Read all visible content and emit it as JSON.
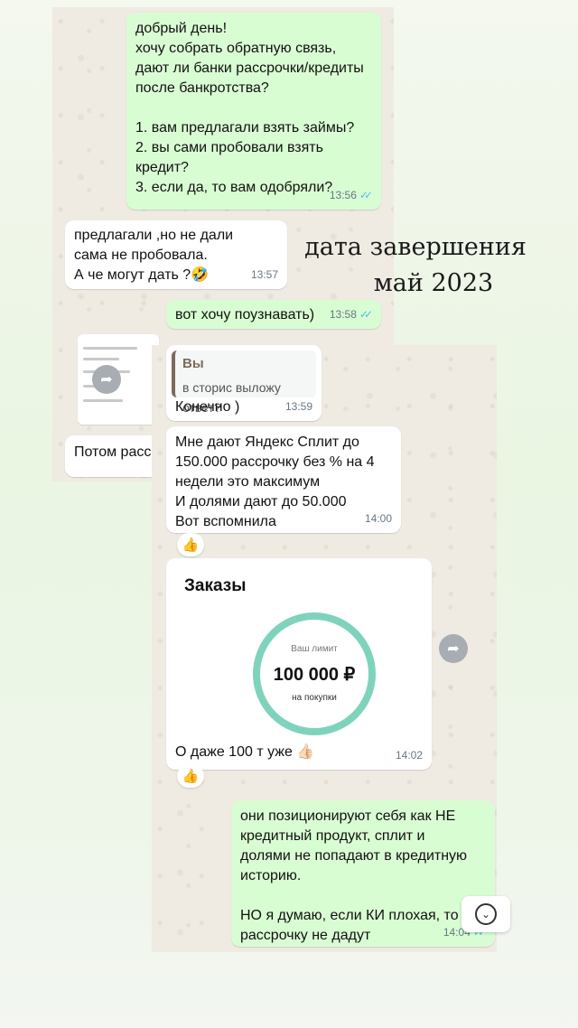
{
  "overlay": {
    "title_line1": "дата завершения",
    "title_line2": "май 2023"
  },
  "chat_top": {
    "msg1": {
      "text": "добрый день!\nхочу собрать обратную связь,\nдают ли банки рассрочки/кредиты\nпосле банкротства?\n\n1. вам предлагали взять займы?\n2. вы сами пробовали взять\n    кредит?\n3. если да, то вам одобряли?",
      "time": "13:56"
    },
    "msg2": {
      "text": "предлагали ,но не дали\nсама не пробовала.\nА че могут дать ?🤣",
      "time": "13:57"
    },
    "msg3": {
      "text": "вот хочу поузнавать)",
      "time": "13:58"
    },
    "msg4_partial": {
      "text": "Потом расс"
    }
  },
  "chat_bottom": {
    "reply": {
      "quote_author": "Вы",
      "quote_text": "в сторис выложу ответ?",
      "text": "Конечно )",
      "time": "13:59"
    },
    "msg_split": {
      "text": "Мне дают Яндекс Сплит до\n150.000 рассрочку без % на 4\nнедели это максимум\nИ долями дают до 50.000\nВот вспомнила",
      "time": "14:00",
      "reaction": "👍"
    },
    "screenshot_msg": {
      "card_title": "Заказы",
      "limit_label": "Ваш лимит",
      "limit_value": "100 000 ₽",
      "limit_note": "на покупки",
      "caption": "О даже 100 т уже 👍🏻",
      "time": "14:02",
      "reaction": "👍"
    },
    "msg_last": {
      "text": "они позиционируют себя как НЕ\nкредитный продукт, сплит и\nдолями не попадают в кредитную\nисторию.\n\nНО я думаю, если КИ плохая, то\nрассрочку не дадут",
      "time": "14:04"
    }
  },
  "icons": {
    "ticks": "✓✓",
    "share": "➦",
    "scroll_down": "⌄"
  }
}
